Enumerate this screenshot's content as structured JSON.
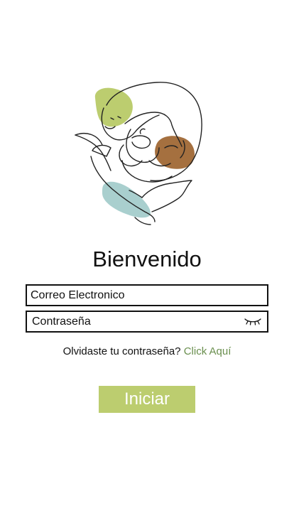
{
  "colors": {
    "accent_green": "#bccd6f",
    "link_green": "#6a8f4e",
    "blob_brown": "#a5703f",
    "blob_teal": "#a9cfce"
  },
  "logo": {
    "icon": "otter-sloth-dolphin-illustration-icon"
  },
  "welcome": {
    "title": "Bienvenido"
  },
  "form": {
    "email_placeholder": "Correo Electronico",
    "password_placeholder": "Contraseña",
    "toggle_icon": "closed-eye-icon"
  },
  "forgot": {
    "text": "Olvidaste tu contraseña?",
    "link": "Click Aquí"
  },
  "submit": {
    "label": "Iniciar"
  }
}
